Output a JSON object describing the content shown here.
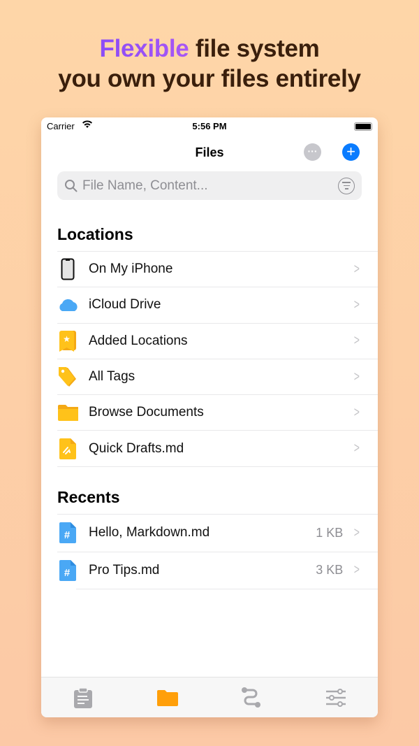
{
  "headline": {
    "accent": "Flexible",
    "line1_rest": " file system",
    "line2": "you own your files entirely"
  },
  "status": {
    "carrier": "Carrier",
    "time": "5:56 PM"
  },
  "nav": {
    "title": "Files"
  },
  "search": {
    "placeholder": "File Name, Content..."
  },
  "locations": {
    "title": "Locations",
    "items": [
      {
        "label": "On My iPhone",
        "icon": "iphone-icon"
      },
      {
        "label": "iCloud Drive",
        "icon": "icloud-icon"
      },
      {
        "label": "Added Locations",
        "icon": "bookmark-star-icon"
      },
      {
        "label": "All Tags",
        "icon": "tag-icon"
      },
      {
        "label": "Browse Documents",
        "icon": "folder-icon"
      },
      {
        "label": "Quick Drafts.md",
        "icon": "draft-icon"
      }
    ]
  },
  "recents": {
    "title": "Recents",
    "items": [
      {
        "label": "Hello, Markdown.md",
        "size": "1 KB"
      },
      {
        "label": "Pro Tips.md",
        "size": "3 KB"
      }
    ]
  },
  "tabs": [
    {
      "icon": "clipboard-icon"
    },
    {
      "icon": "folder-icon",
      "active": true
    },
    {
      "icon": "route-icon"
    },
    {
      "icon": "sliders-icon"
    }
  ],
  "colors": {
    "accent": "#0a7cff",
    "folder": "#ff9f0a",
    "yellow": "#ffc21a"
  }
}
